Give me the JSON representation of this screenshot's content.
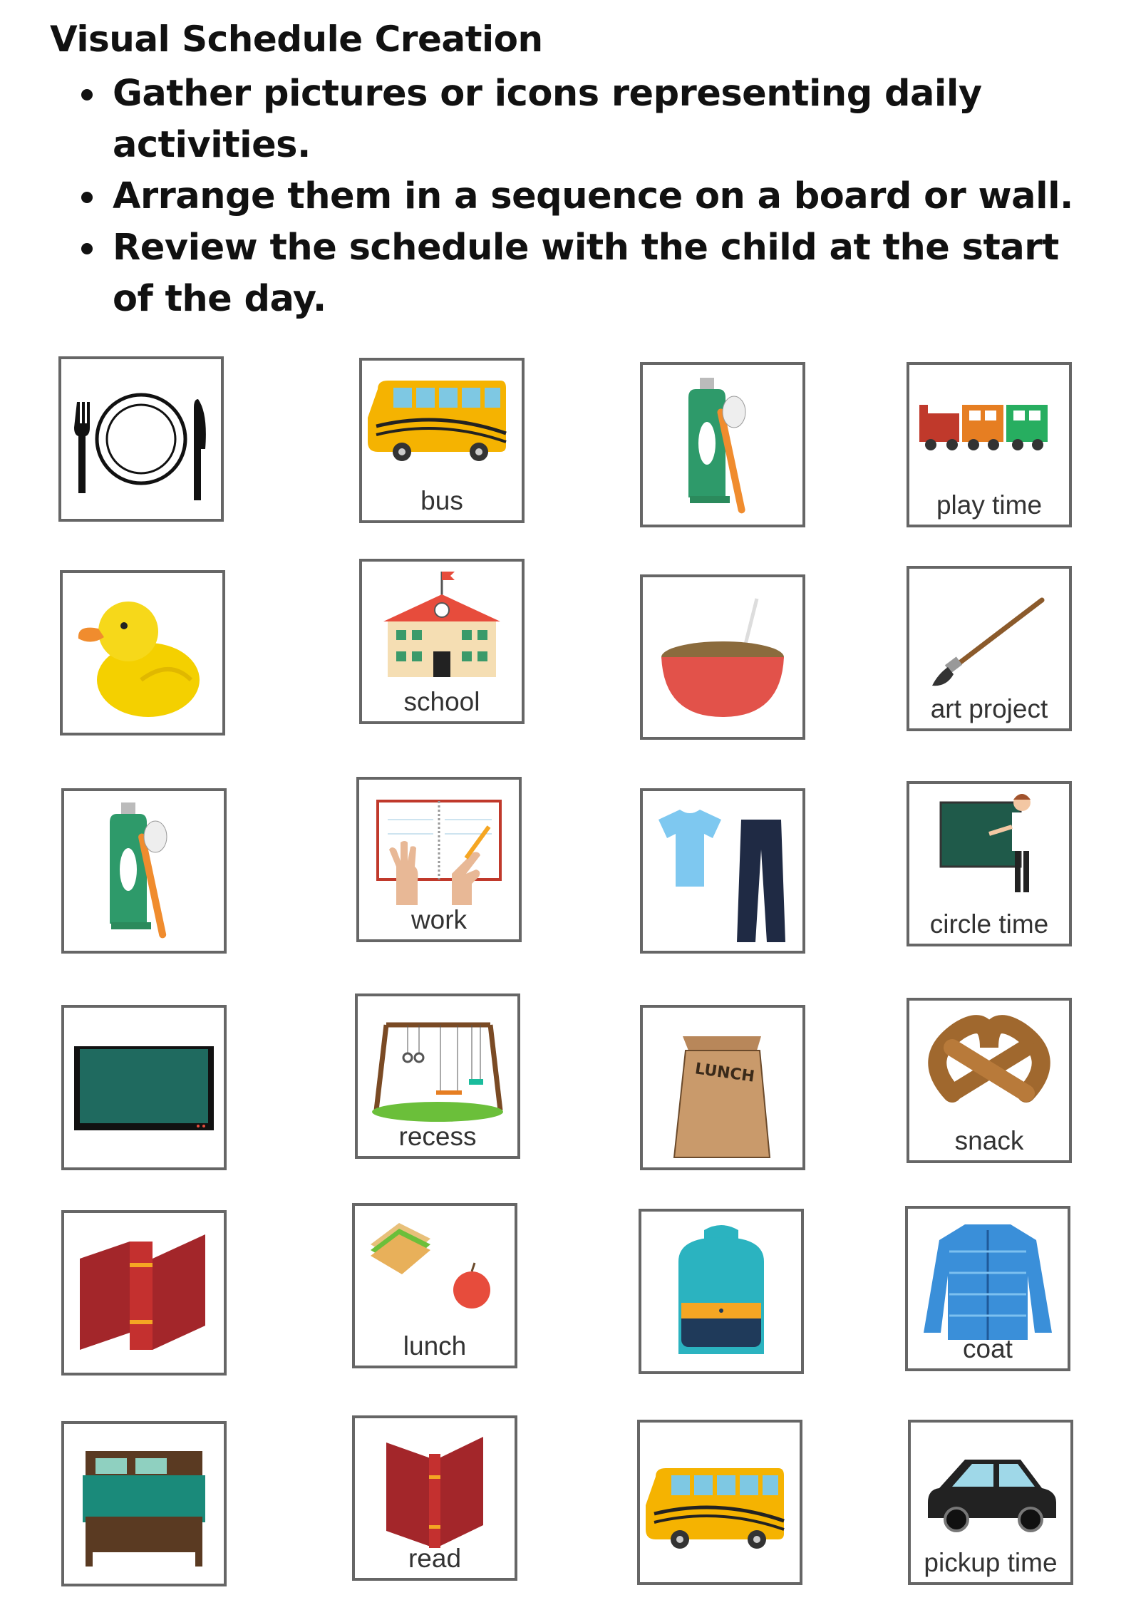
{
  "document": {
    "title": "Visual Schedule Creation",
    "steps": [
      "Gather pictures or icons representing daily activities.",
      "Arrange them in a sequence on a board or wall.",
      "Review the schedule with the child at the start of the day."
    ]
  },
  "cards": [
    {
      "icon": "plate-fork-knife-icon",
      "label": ""
    },
    {
      "icon": "school-bus-icon",
      "label": "bus"
    },
    {
      "icon": "toothpaste-toothbrush-icon",
      "label": ""
    },
    {
      "icon": "toy-train-icon",
      "label": "play time"
    },
    {
      "icon": "rubber-duck-icon",
      "label": ""
    },
    {
      "icon": "school-building-icon",
      "label": "school"
    },
    {
      "icon": "cereal-bowl-icon",
      "label": ""
    },
    {
      "icon": "paintbrush-icon",
      "label": "art project"
    },
    {
      "icon": "toothpaste-toothbrush-icon",
      "label": ""
    },
    {
      "icon": "hands-writing-notebook-icon",
      "label": "work"
    },
    {
      "icon": "shirt-pants-icon",
      "label": ""
    },
    {
      "icon": "teacher-chalkboard-icon",
      "label": "circle time"
    },
    {
      "icon": "television-icon",
      "label": ""
    },
    {
      "icon": "swing-set-icon",
      "label": "recess"
    },
    {
      "icon": "lunch-bag-icon",
      "label": ""
    },
    {
      "icon": "pretzel-icon",
      "label": "snack"
    },
    {
      "icon": "red-book-icon",
      "label": ""
    },
    {
      "icon": "sandwich-apple-icon",
      "label": "lunch"
    },
    {
      "icon": "backpack-icon",
      "label": ""
    },
    {
      "icon": "puffer-coat-icon",
      "label": "coat"
    },
    {
      "icon": "bed-icon",
      "label": ""
    },
    {
      "icon": "open-book-icon",
      "label": "read"
    },
    {
      "icon": "school-bus-icon",
      "label": ""
    },
    {
      "icon": "black-car-icon",
      "label": "pickup time"
    }
  ],
  "icon_text": {
    "lunch_bag": "LUNCH"
  },
  "colors": {
    "card_border": "#666666",
    "label_text": "#333333",
    "bus_yellow": "#f5b301",
    "book_red": "#a3262a"
  }
}
